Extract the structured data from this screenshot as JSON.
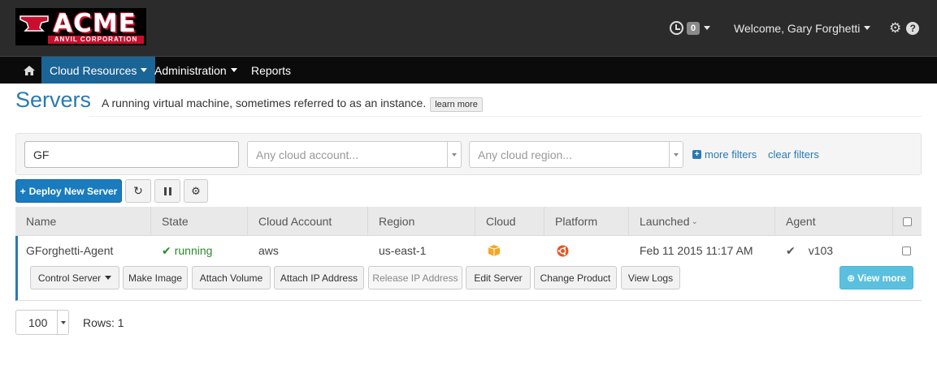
{
  "brand": {
    "name": "ACME",
    "tagline": "ANVIL CORPORATION"
  },
  "topbar": {
    "history_count": "0",
    "welcome": "Welcome, Gary Forghetti"
  },
  "nav": [
    {
      "label": "Cloud Resources",
      "active": true
    },
    {
      "label": "Administration",
      "active": false
    },
    {
      "label": "Reports",
      "active": false
    }
  ],
  "page": {
    "title": "Servers",
    "subtitle": "A running virtual machine, sometimes referred to as an instance.",
    "learn_more": "learn more"
  },
  "filters": {
    "search_value": "GF",
    "cloud_account_placeholder": "Any cloud account...",
    "cloud_region_placeholder": "Any cloud region...",
    "more_filters": "more filters",
    "clear_filters": "clear filters"
  },
  "toolbar": {
    "deploy_label": "Deploy New Server"
  },
  "table": {
    "columns": [
      "Name",
      "State",
      "Cloud Account",
      "Region",
      "Cloud",
      "Platform",
      "Launched",
      "Agent"
    ],
    "sort_column": "Launched",
    "rows": [
      {
        "name": "GForghetti-Agent",
        "state": "running",
        "cloud_account": "aws",
        "region": "us-east-1",
        "cloud_icon": "aws-box-icon",
        "platform_icon": "ubuntu-icon",
        "launched": "Feb 11 2015 11:17 AM",
        "agent": "v103"
      }
    ],
    "row_actions": [
      {
        "label": "Control Server",
        "dropdown": true,
        "disabled": false
      },
      {
        "label": "Make Image",
        "disabled": false
      },
      {
        "label": "Attach Volume",
        "disabled": false
      },
      {
        "label": "Attach IP Address",
        "disabled": false
      },
      {
        "label": "Release IP Address",
        "disabled": true
      },
      {
        "label": "Edit Server",
        "disabled": false
      },
      {
        "label": "Change Product",
        "disabled": false
      },
      {
        "label": "View Logs",
        "disabled": false
      }
    ],
    "view_more": "View more"
  },
  "footer": {
    "page_size": "100",
    "rows_label": "Rows: 1"
  },
  "colors": {
    "primary": "#1a7bbf",
    "link": "#2a7ab3",
    "running": "#2a8a2a",
    "brand_red": "#c8102e",
    "info": "#5bc0de"
  }
}
